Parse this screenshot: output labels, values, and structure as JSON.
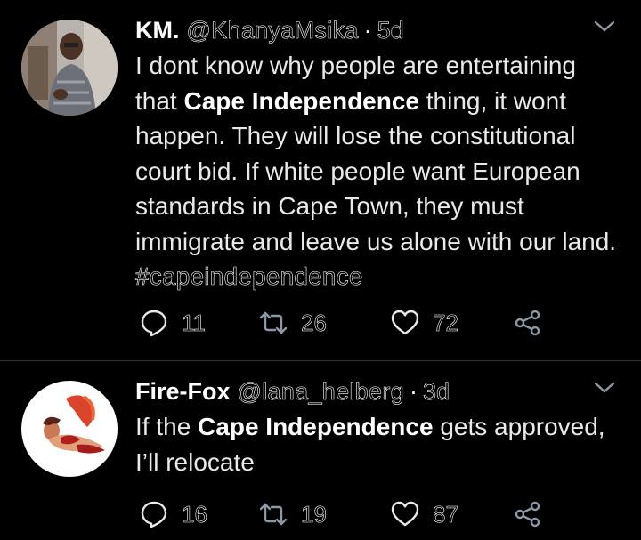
{
  "colors": {
    "background": "#000000",
    "text": "#e7e9ea",
    "divider": "#2f3336",
    "icon": "#8b98a5"
  },
  "tweets": [
    {
      "display_name": "KM.",
      "handle": "@KhanyaMsika",
      "separator": "·",
      "age": "5d",
      "text_1": "I dont know why people are entertaining that ",
      "bold": "Cape Independence",
      "text_2": " thing, it wont happen. They will lose the constitutional court bid. If white people want European standards in Cape Town, they must immigrate and leave us alone with our land. ",
      "hashtag": "#capeindependence",
      "replies": "11",
      "retweets": "26",
      "likes": "72",
      "icons": [
        "reply-icon",
        "retweet-icon",
        "like-icon",
        "share-icon",
        "chevron-down-icon"
      ]
    },
    {
      "display_name": "Fire-Fox",
      "handle": "@lana_helberg",
      "separator": "·",
      "age": "3d",
      "text_1": "If the ",
      "bold": "Cape Independence",
      "text_2": " gets approved, I’ll relocate",
      "replies": "16",
      "retweets": "19",
      "likes": "87",
      "icons": [
        "reply-icon",
        "retweet-icon",
        "like-icon",
        "share-icon",
        "chevron-down-icon"
      ]
    }
  ]
}
